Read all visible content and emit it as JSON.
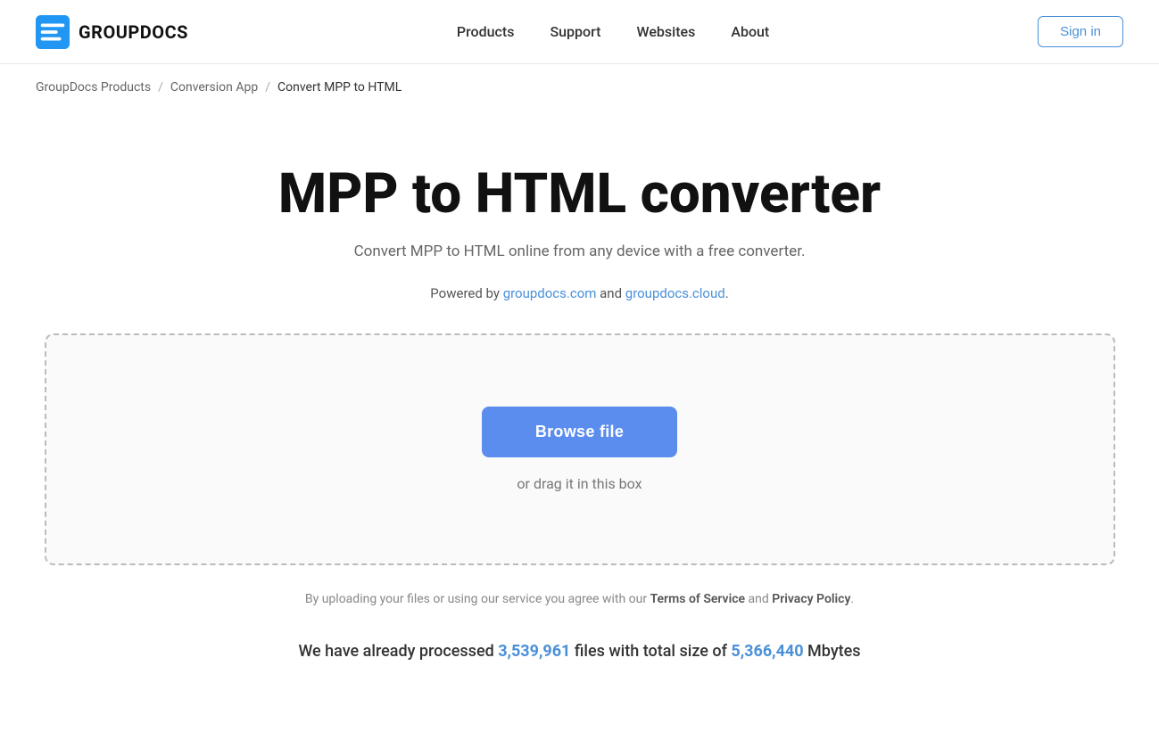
{
  "header": {
    "logo_text": "GROUPDOCS",
    "nav": {
      "products": "Products",
      "support": "Support",
      "websites": "Websites",
      "about": "About"
    },
    "signin_label": "Sign in"
  },
  "breadcrumb": {
    "root": "GroupDocs Products",
    "section": "Conversion App",
    "current": "Convert MPP to HTML"
  },
  "main": {
    "title": "MPP to HTML converter",
    "subtitle": "Convert MPP to HTML online from any device with a free converter.",
    "powered_by_prefix": "Powered by ",
    "powered_by_link1": "groupdocs.com",
    "powered_by_url1": "#",
    "powered_by_mid": " and ",
    "powered_by_link2": "groupdocs.cloud",
    "powered_by_url2": "#",
    "powered_by_suffix": ".",
    "browse_btn": "Browse file",
    "drag_text": "or drag it in this box",
    "tos_prefix": "By uploading your files or using our service you agree with our ",
    "tos_link": "Terms of Service",
    "tos_mid": " and ",
    "privacy_link": "Privacy Policy",
    "tos_suffix": ".",
    "stats_prefix": "We have already processed ",
    "stats_files": "3,539,961",
    "stats_mid": " files with total size of ",
    "stats_size": "5,366,440",
    "stats_suffix": " Mbytes"
  }
}
